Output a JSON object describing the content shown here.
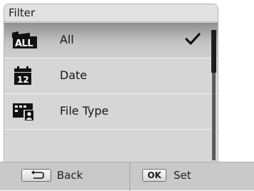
{
  "title": "Filter",
  "menu": {
    "items": [
      {
        "label": "All",
        "icon": "all-files-icon",
        "selected": true
      },
      {
        "label": "Date",
        "icon": "calendar-icon",
        "selected": false
      },
      {
        "label": "File Type",
        "icon": "file-type-icon",
        "selected": false
      }
    ]
  },
  "bottom_bar": {
    "back_label": "Back",
    "ok_key_label": "OK",
    "set_label": "Set"
  },
  "colors": {
    "panel_bg": "#d6d6d6",
    "selected_row": "#8f8f8f",
    "scroll_thumb": "#1d1d1d",
    "bottom_bar": "#c9c9c9"
  }
}
